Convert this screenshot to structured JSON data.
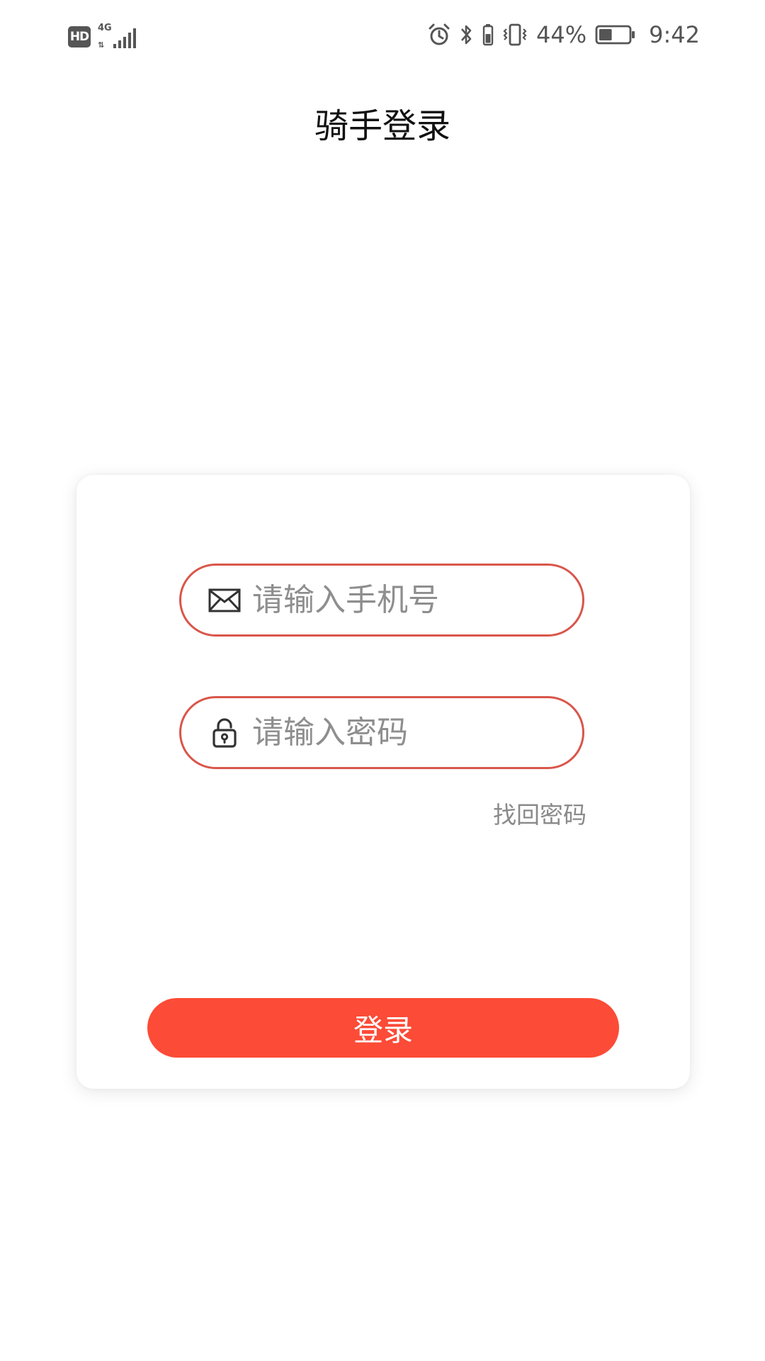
{
  "status_bar": {
    "hd_label": "HD",
    "network_label": "4G",
    "battery_percent_text": "44%",
    "battery_level": 0.44,
    "time": "9:42",
    "icons": [
      "alarm-icon",
      "bluetooth-icon",
      "vibrate-icon",
      "battery-icon"
    ]
  },
  "page": {
    "title": "骑手登录"
  },
  "login_form": {
    "phone_placeholder": "请输入手机号",
    "phone_icon": "mail-icon",
    "password_placeholder": "请输入密码",
    "password_icon": "lock-icon",
    "forgot_password_label": "找回密码",
    "login_button_label": "登录"
  },
  "colors": {
    "accent": "#fc4b37",
    "field_border": "#d9564a",
    "placeholder": "#8e8e8e",
    "link": "#8a8a8a"
  }
}
